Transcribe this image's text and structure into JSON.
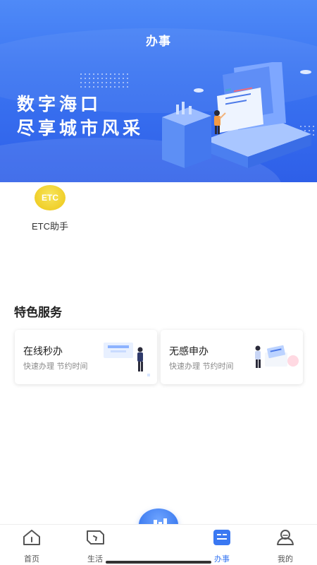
{
  "header": {
    "title": "办事"
  },
  "banner": {
    "line1": "数字海口",
    "line2": "尽享城市风采"
  },
  "quick_services": [
    {
      "icon_text": "ETC",
      "icon": "etc-icon",
      "label": "ETC助手",
      "icon_color": "#f0cf2a"
    }
  ],
  "featured": {
    "title": "特色服务",
    "cards": [
      {
        "title": "在线秒办",
        "subtitle": "快速办理 节约时间"
      },
      {
        "title": "无感申办",
        "subtitle": "快速办理 节约时间"
      }
    ]
  },
  "tabbar": {
    "items": [
      {
        "label": "首页",
        "icon": "home-icon",
        "active": false
      },
      {
        "label": "生活",
        "icon": "life-icon",
        "active": false
      },
      {
        "label": "",
        "icon": "city-icon",
        "active": false
      },
      {
        "label": "办事",
        "icon": "services-icon",
        "active": true
      },
      {
        "label": "我的",
        "icon": "profile-icon",
        "active": false
      }
    ],
    "active_color": "#3a78f2"
  },
  "colors": {
    "primary": "#3b75f2",
    "accent_yellow": "#f0cf2a"
  }
}
